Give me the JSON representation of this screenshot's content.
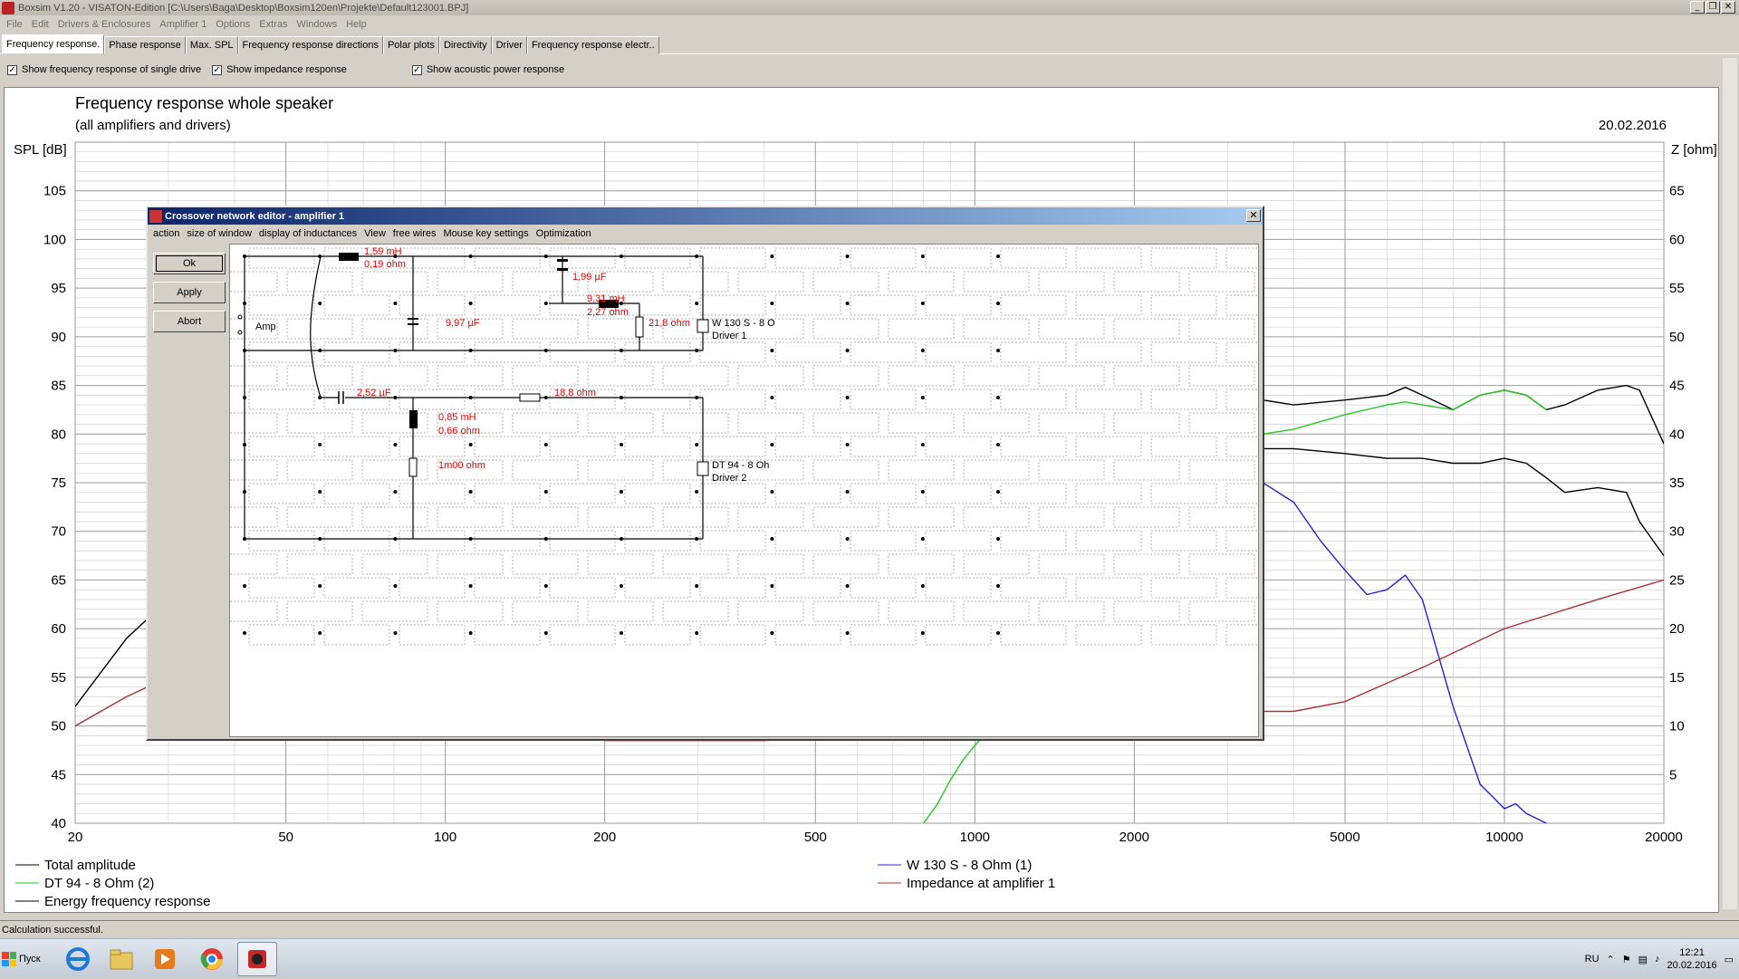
{
  "window": {
    "title": "Boxsim V1.20 - VISATON-Edition [C:\\Users\\Baga\\Desktop\\Boxsim120en\\Projekte\\Default123001.BPJ]",
    "min_icon": "minimize-icon",
    "restore_icon": "restore-icon",
    "close_icon": "close-icon"
  },
  "menu": [
    "File",
    "Edit",
    "Drivers & Enclosures",
    "Amplifier 1",
    "Options",
    "Extras",
    "Windows",
    "Help"
  ],
  "tabs": [
    "Frequency response.",
    "Phase response",
    "Max. SPL",
    "Frequency response directions",
    "Polar plots",
    "Directivity",
    "Driver",
    "Frequency response electr.."
  ],
  "active_tab": "Frequency response.",
  "options": [
    {
      "label": "Show frequency response of single drive",
      "checked": true
    },
    {
      "label": "Show impedance response",
      "checked": true
    },
    {
      "label": "Show acoustic power response",
      "checked": true
    }
  ],
  "chart_data": {
    "type": "line",
    "title": "Frequency response whole speaker",
    "subtitle": "(all amplifiers and drivers)",
    "date": "20.02.2016",
    "ylabel": "SPL [dB]",
    "y2label": "Z [ohm]",
    "xscale": "log",
    "xlim": [
      20,
      20000
    ],
    "ylim": [
      40,
      110
    ],
    "y2lim": [
      0,
      70
    ],
    "xticks": [
      20,
      50,
      100,
      200,
      500,
      1000,
      2000,
      5000,
      10000,
      20000
    ],
    "yticks": [
      40,
      45,
      50,
      55,
      60,
      65,
      70,
      75,
      80,
      85,
      90,
      95,
      100,
      105
    ],
    "y2ticks": [
      5,
      10,
      15,
      20,
      25,
      30,
      35,
      40,
      45,
      50,
      55,
      60,
      65
    ],
    "grid": true,
    "series": [
      {
        "name": "Total amplitude",
        "color": "#000000",
        "axis": "left",
        "x": [
          20,
          22,
          25,
          30,
          3500,
          4000,
          5000,
          6000,
          6500,
          7000,
          8000,
          9000,
          10000,
          11000,
          12000,
          13000,
          15000,
          17000,
          18000,
          20000
        ],
        "y": [
          52,
          55,
          59,
          63,
          83.5,
          83,
          83.5,
          84,
          84.8,
          84,
          82.5,
          84,
          84.5,
          84,
          82.5,
          83,
          84.5,
          85,
          84.5,
          79
        ]
      },
      {
        "name": "DT 94 - 8 Ohm (2)",
        "color": "#22cc22",
        "axis": "left",
        "x": [
          800,
          850,
          900,
          950,
          1000,
          3500,
          4000,
          5000,
          6000,
          6500,
          7000,
          8000,
          9000,
          10000,
          11000,
          12000
        ],
        "y": [
          40,
          42,
          44.5,
          46.5,
          48,
          80,
          80.5,
          82,
          83,
          83.3,
          83,
          82.5,
          84,
          84.5,
          84,
          82.5
        ]
      },
      {
        "name": "Energy frequency response",
        "color": "#000000",
        "axis": "left",
        "x": [
          3500,
          4000,
          5000,
          6000,
          7000,
          8000,
          9000,
          10000,
          11000,
          12000,
          13000,
          15000,
          17000,
          18000,
          20000
        ],
        "y": [
          78.5,
          78.5,
          78,
          77.5,
          77.5,
          77,
          77,
          77.5,
          77,
          75.5,
          74,
          74.5,
          74,
          71,
          67.5
        ]
      },
      {
        "name": "W 130 S - 8 Ohm (1)",
        "color": "#2222dd",
        "axis": "left",
        "x": [
          3500,
          4000,
          4500,
          5000,
          5500,
          6000,
          6500,
          7000,
          8000,
          9000,
          10000,
          10500,
          11000,
          12000
        ],
        "y": [
          75,
          73,
          69,
          66,
          63.5,
          64,
          65.5,
          63,
          52,
          44,
          41.5,
          42,
          41,
          40
        ]
      },
      {
        "name": "Impedance at amplifier 1",
        "color": "#aa3333",
        "axis": "right",
        "x": [
          20,
          25,
          30,
          50,
          100,
          200,
          400,
          600,
          1000,
          3500,
          4000,
          5000,
          7000,
          10000,
          15000,
          20000
        ],
        "y": [
          10,
          13,
          15,
          22,
          18,
          8.5,
          8.5,
          9,
          11,
          11.5,
          11.5,
          12.5,
          16,
          20,
          23,
          25
        ]
      }
    ]
  },
  "dialog": {
    "title": "Crossover network editor - amplifier 1",
    "menu": [
      "action",
      "size of window",
      "display of inductances",
      "View",
      "free wires",
      "Mouse key settings",
      "Optimization"
    ],
    "buttons": {
      "ok": "Ok",
      "apply": "Apply",
      "abort": "Abort"
    },
    "close_icon": "close-icon",
    "components": {
      "amp": "Amp",
      "l1_value": "1,59 mH",
      "l1_res": "0,19 ohm",
      "c1": "1,99 µF",
      "l2_value": "9,31 mH",
      "l2_res": "2,27 ohm",
      "c2": "9,97 µF",
      "r1": "21,8 ohm",
      "driver1_name": "W 130 S - 8 O",
      "driver1_label": "Driver 1",
      "c3": "2,52 µF",
      "r2": "18,8 ohm",
      "l3_value": "0,85 mH",
      "l3_res": "0,66 ohm",
      "r3": "1m00 ohm",
      "driver2_name": "DT 94 - 8 Oh",
      "driver2_label": "Driver 2"
    }
  },
  "legend": [
    "Total amplitude",
    "DT 94 - 8 Ohm (2)",
    "Energy frequency response",
    "W 130 S - 8 Ohm (1)",
    "Impedance at amplifier 1"
  ],
  "status": "Calculation successful.",
  "taskbar": {
    "start_label": "Пуск",
    "lang": "RU",
    "time": "12:21",
    "date": "20.02.2016"
  }
}
